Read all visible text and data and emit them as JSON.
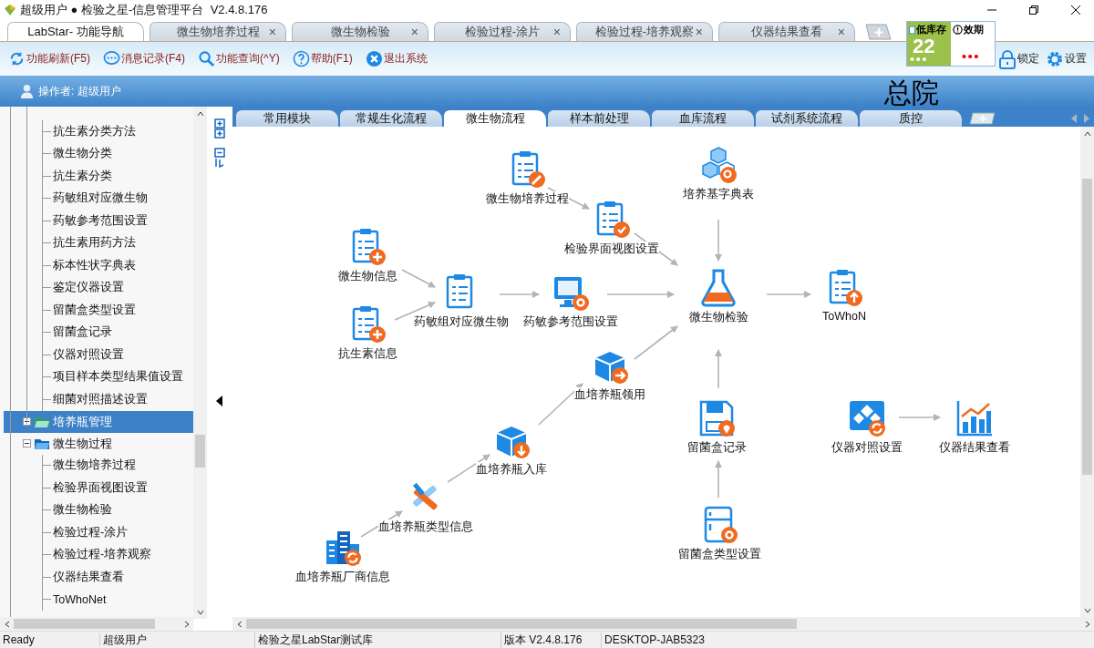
{
  "window": {
    "title": "超级用户 ● 检验之星-信息管理平台  V2.4.8.176"
  },
  "doc_tabs": [
    {
      "label": "LabStar- 功能导航",
      "selected": true
    },
    {
      "label": "微生物培养过程",
      "selected": false,
      "close": "×"
    },
    {
      "label": "微生物检验",
      "selected": false,
      "close": "×"
    },
    {
      "label": "检验过程-涂片",
      "selected": false,
      "close": "×"
    },
    {
      "label": "检验过程-培养观察",
      "selected": false,
      "close": "×"
    },
    {
      "label": "仪器结果查看",
      "selected": false,
      "close": "×"
    }
  ],
  "alerts": {
    "low_stock_label": "低库存",
    "low_stock_count": "22",
    "expiry_label": "效期"
  },
  "toolbar": [
    {
      "label": "功能刷新(F5)"
    },
    {
      "label": "消息记录(F4)"
    },
    {
      "label": "功能查询(^Y)"
    },
    {
      "label": "帮助(F1)"
    },
    {
      "label": "退出系统"
    }
  ],
  "toolbar_right": [
    {
      "label": "锁定"
    },
    {
      "label": "设置"
    }
  ],
  "operator": "操作者: 超级用户",
  "site": "总院",
  "tree": {
    "items_above": [
      {
        "label": "抗生素分类方法",
        "selected": false
      },
      {
        "label": "微生物分类",
        "selected": false
      },
      {
        "label": "抗生素分类",
        "selected": false
      },
      {
        "label": "药敏组对应微生物",
        "selected": false
      },
      {
        "label": "药敏参考范围设置",
        "selected": false
      },
      {
        "label": "抗生素用药方法",
        "selected": false
      },
      {
        "label": "标本性状字典表",
        "selected": false
      },
      {
        "label": "鉴定仪器设置",
        "selected": false
      },
      {
        "label": "留菌盒类型设置",
        "selected": false
      },
      {
        "label": "留菌盒记录",
        "selected": false
      },
      {
        "label": "仪器对照设置",
        "selected": false
      },
      {
        "label": "项目样本类型结果值设置",
        "selected": false
      },
      {
        "label": "细菌对照描述设置",
        "selected": false
      }
    ],
    "nodes": [
      {
        "label": "培养瓶管理",
        "selected": true,
        "expanded": false
      },
      {
        "label": "微生物过程",
        "selected": false,
        "expanded": true,
        "children": [
          {
            "label": "微生物培养过程",
            "selected": false
          },
          {
            "label": "检验界面视图设置",
            "selected": false
          },
          {
            "label": "微生物检验",
            "selected": false
          },
          {
            "label": "检验过程-涂片",
            "selected": false
          },
          {
            "label": "检验过程-培养观察",
            "selected": false
          },
          {
            "label": "仪器结果查看",
            "selected": false
          },
          {
            "label": "ToWhoNet",
            "selected": false
          }
        ]
      }
    ]
  },
  "module_tabs": [
    {
      "label": "常用模块",
      "selected": false
    },
    {
      "label": "常规生化流程",
      "selected": false
    },
    {
      "label": "微生物流程",
      "selected": true
    },
    {
      "label": "样本前处理",
      "selected": false
    },
    {
      "label": "血库流程",
      "selected": false
    },
    {
      "label": "试剂系统流程",
      "selected": false
    },
    {
      "label": "质控",
      "selected": false
    }
  ],
  "flow_nodes": [
    {
      "label": "微生物培养过程"
    },
    {
      "label": "检验界面视图设置"
    },
    {
      "label": "培养基字典表"
    },
    {
      "label": "微生物信息"
    },
    {
      "label": "药敏组对应微生物"
    },
    {
      "label": "药敏参考范围设置"
    },
    {
      "label": "微生物检验"
    },
    {
      "label": "ToWhoN"
    },
    {
      "label": "抗生素信息"
    },
    {
      "label": "血培养瓶领用"
    },
    {
      "label": "留菌盒记录"
    },
    {
      "label": "仪器对照设置"
    },
    {
      "label": "仪器结果查看"
    },
    {
      "label": "血培养瓶入库"
    },
    {
      "label": "血培养瓶类型信息"
    },
    {
      "label": "血培养瓶厂商信息"
    },
    {
      "label": "留菌盒类型设置"
    }
  ],
  "status_bar": [
    "Ready",
    "超级用户",
    "检验之星LabStar测试库",
    "版本 V2.4.8.176",
    "DESKTOP-JAB5323"
  ]
}
